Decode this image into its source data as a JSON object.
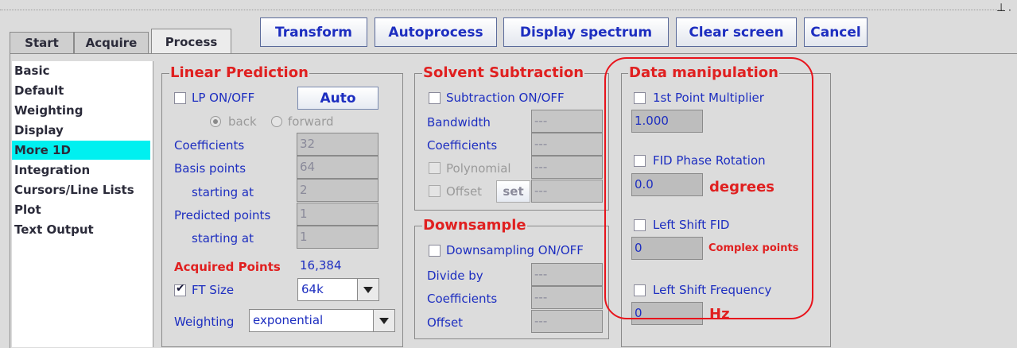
{
  "tabs": [
    {
      "label": "Start"
    },
    {
      "label": "Acquire"
    },
    {
      "label": "Process"
    }
  ],
  "toolbar": {
    "transform": "Transform",
    "autoprocess": "Autoprocess",
    "display_spectrum": "Display spectrum",
    "clear_screen": "Clear screen",
    "cancel": "Cancel"
  },
  "nav": {
    "items": [
      {
        "label": "Basic"
      },
      {
        "label": "Default"
      },
      {
        "label": "Weighting"
      },
      {
        "label": "Display"
      },
      {
        "label": "More 1D"
      },
      {
        "label": "Integration"
      },
      {
        "label": "Cursors/Line Lists"
      },
      {
        "label": "Plot"
      },
      {
        "label": "Text Output"
      }
    ],
    "selected": "More 1D"
  },
  "linear_prediction": {
    "title": "Linear Prediction",
    "lp_onoff": "LP ON/OFF",
    "auto": "Auto",
    "back": "back",
    "forward": "forward",
    "coefficients_label": "Coefficients",
    "coefficients_value": "32",
    "basis_points_label": "Basis points",
    "basis_points_value": "64",
    "starting_at_label": "starting at",
    "basis_start_value": "2",
    "predicted_points_label": "Predicted points",
    "predicted_points_value": "1",
    "predicted_start_value": "1",
    "acquired_points_label": "Acquired Points",
    "acquired_points_value": "16,384",
    "ft_size_label": "FT Size",
    "ft_size_checked": true,
    "ft_size_value": "64k",
    "weighting_label": "Weighting",
    "weighting_value": "exponential"
  },
  "solvent_subtraction": {
    "title": "Solvent Subtraction",
    "onoff": "Subtraction ON/OFF",
    "bandwidth_label": "Bandwidth",
    "bandwidth_value": "---",
    "coefficients_label": "Coefficients",
    "coefficients_value": "---",
    "polynomial_label": "Polynomial",
    "polynomial_value": "---",
    "offset_label": "Offset",
    "set_label": "set",
    "offset_value": "---"
  },
  "downsample": {
    "title": "Downsample",
    "onoff": "Downsampling ON/OFF",
    "divide_by_label": "Divide by",
    "divide_by_value": "---",
    "coefficients_label": "Coefficients",
    "coefficients_value": "---",
    "offset_label": "Offset",
    "offset_value": "---"
  },
  "data_manipulation": {
    "title": "Data manipulation",
    "first_point_label": "1st Point Multiplier",
    "first_point_value": "1.000",
    "fid_phase_label": "FID Phase Rotation",
    "fid_phase_value": "0.0",
    "fid_phase_unit": "degrees",
    "left_shift_fid_label": "Left Shift FID",
    "left_shift_fid_value": "0",
    "left_shift_fid_unit": "Complex points",
    "left_shift_freq_label": "Left Shift Frequency",
    "left_shift_freq_value": "0",
    "left_shift_freq_unit": "Hz"
  },
  "colors": {
    "accent_red": "#e02020",
    "label_blue": "#1d2ec0",
    "selection_cyan": "#00f0f0",
    "annotation_red": "#e8141c"
  }
}
